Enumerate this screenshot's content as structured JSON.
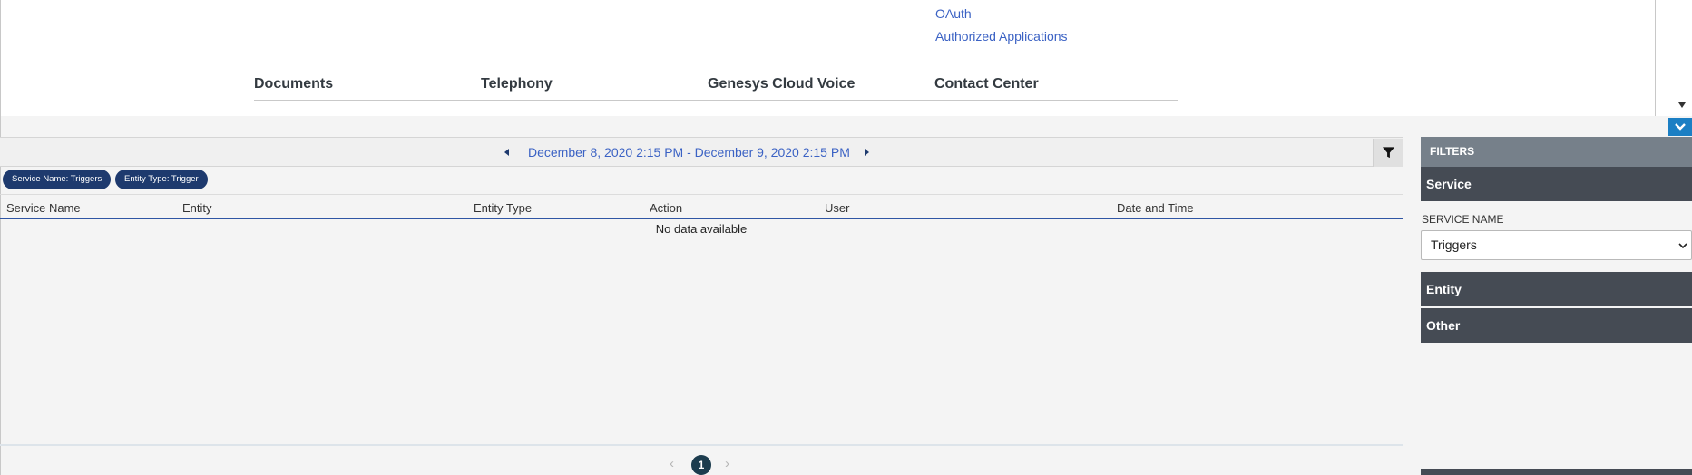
{
  "admin_menu": {
    "links": [
      "OAuth",
      "Authorized Applications"
    ],
    "sections": [
      "Documents",
      "Telephony",
      "Genesys Cloud Voice",
      "Contact Center"
    ]
  },
  "date_range": {
    "label": "December 8, 2020 2:15 PM - December 9, 2020 2:15 PM"
  },
  "active_filters": [
    "Service Name: Triggers",
    "Entity Type: Trigger"
  ],
  "table": {
    "columns": [
      "Service Name",
      "Entity",
      "Entity Type",
      "Action",
      "User",
      "Date and Time"
    ],
    "rows": [],
    "empty_message": "No data available"
  },
  "pagination": {
    "current_page": "1",
    "prev_icon": "chevron-left-icon",
    "next_icon": "chevron-right-icon"
  },
  "filters_panel": {
    "title": "FILTERS",
    "groups": [
      "Service",
      "Entity",
      "Other"
    ],
    "service_name_label": "SERVICE NAME",
    "service_name_value": "Triggers"
  },
  "colors": {
    "link": "#3b62c4",
    "chip": "#1e3a6e",
    "toggle_button": "#1b7fc4",
    "group_header": "#454b54",
    "filters_header": "#76808a",
    "table_header_underline": "#2f55a4"
  }
}
